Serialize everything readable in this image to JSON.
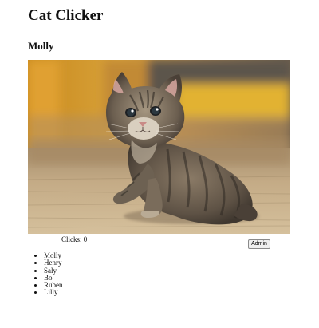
{
  "app": {
    "title": "Cat Clicker"
  },
  "current_cat": {
    "name": "Molly",
    "clicks_label": "Clicks:",
    "clicks": "0",
    "image_alt": "kitten-photo"
  },
  "admin": {
    "button_label": "Admin"
  },
  "cat_list": [
    {
      "name": "Molly"
    },
    {
      "name": "Henry"
    },
    {
      "name": "Saly"
    },
    {
      "name": "Bo"
    },
    {
      "name": "Ruben"
    },
    {
      "name": "Lilly"
    }
  ]
}
